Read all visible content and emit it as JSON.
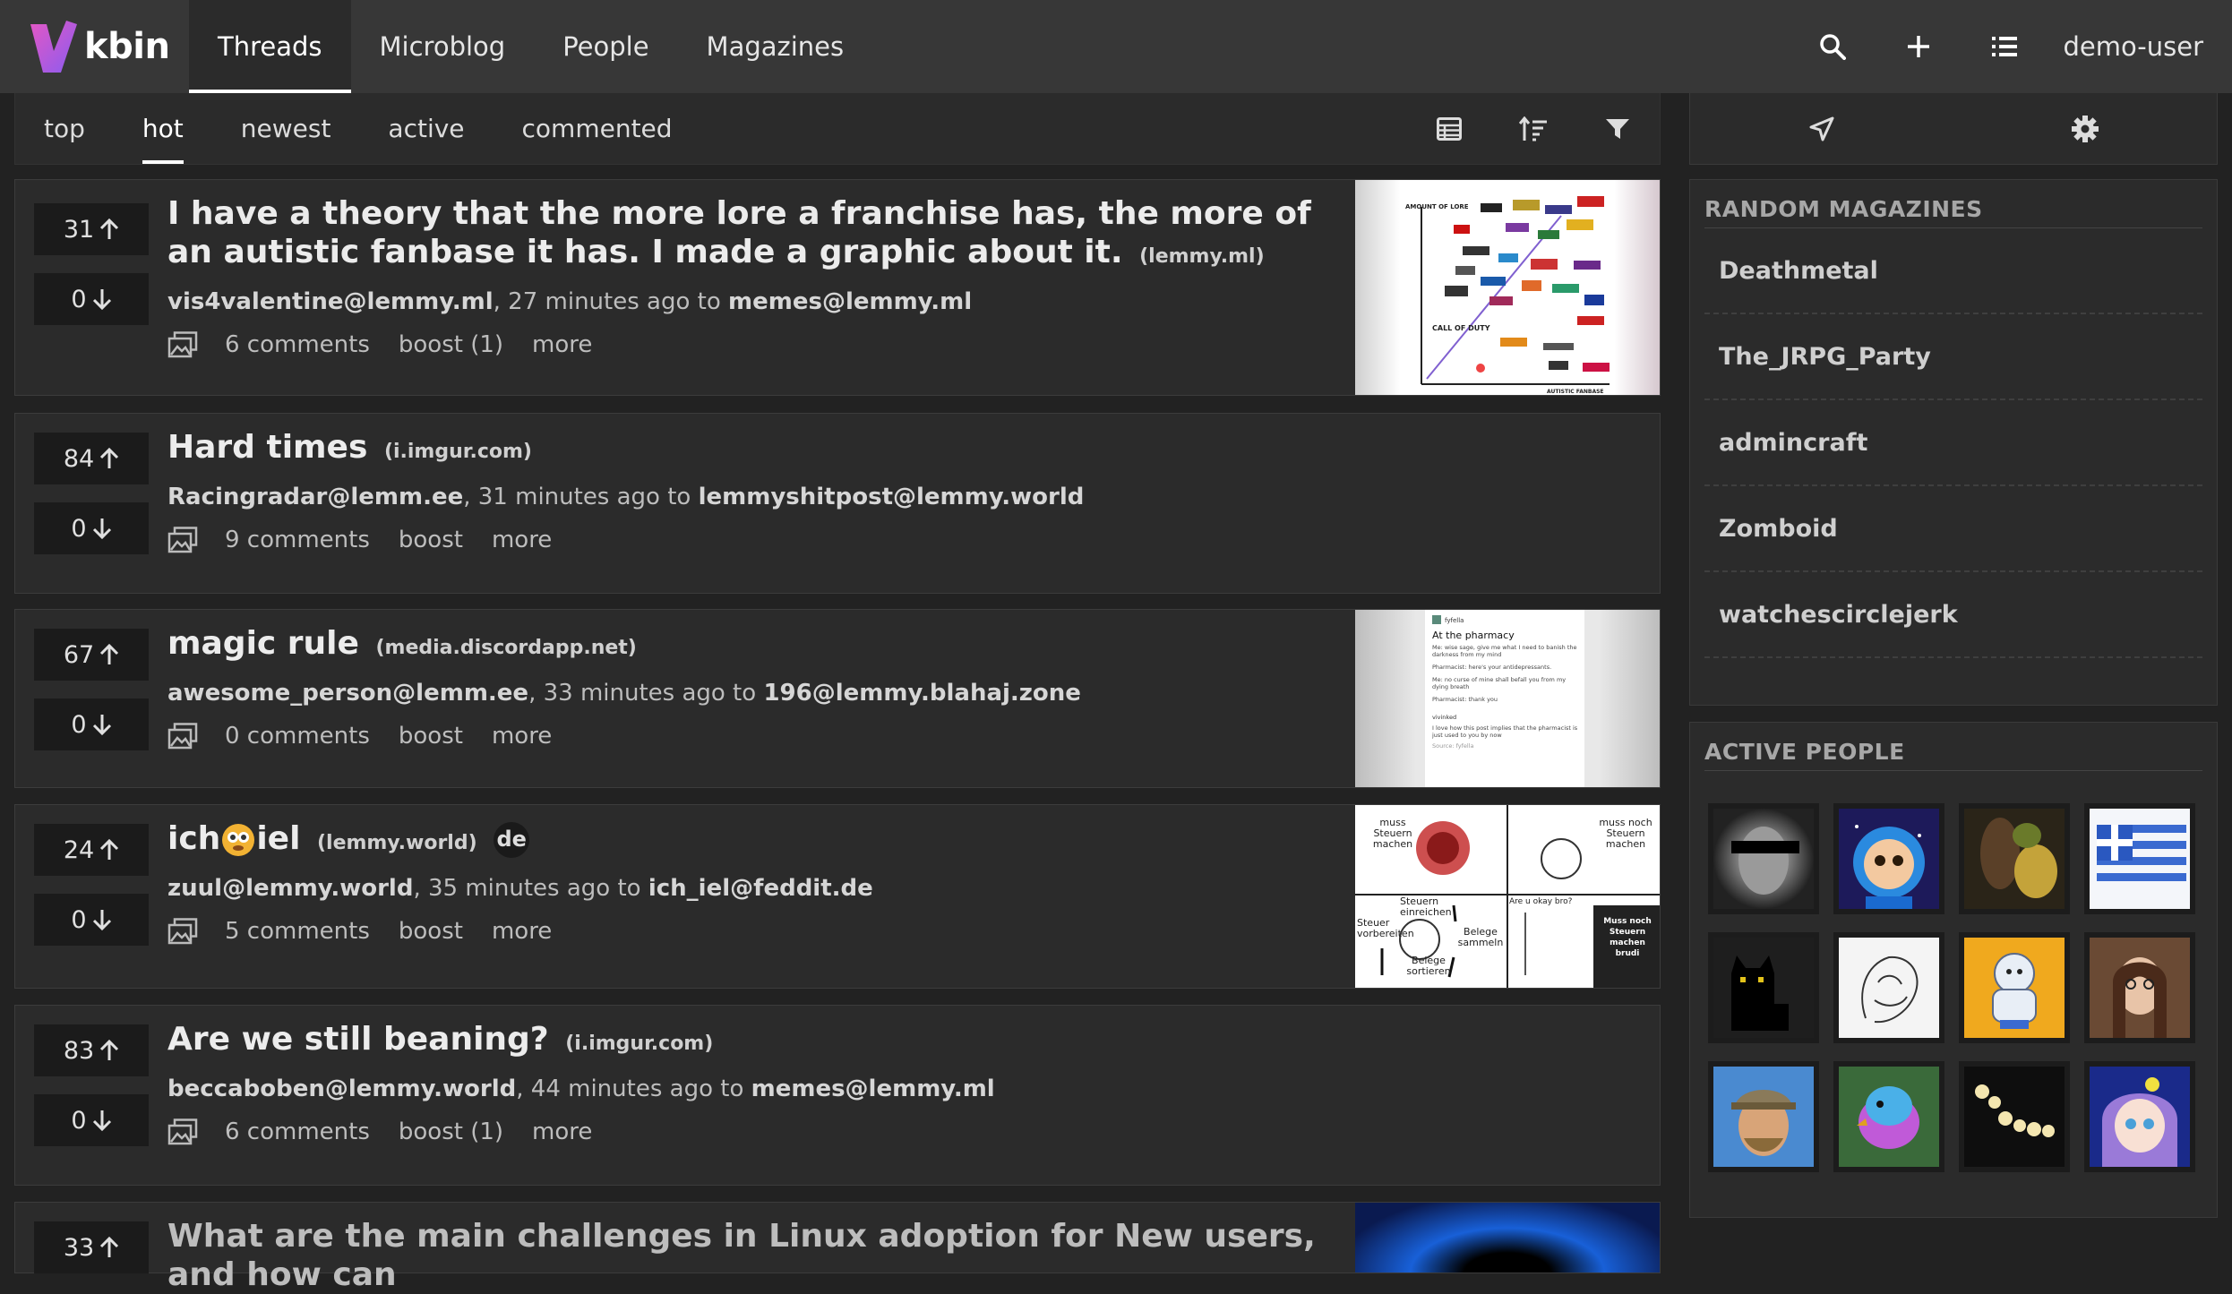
{
  "brand": {
    "name": "kbin"
  },
  "nav": {
    "tabs": [
      {
        "label": "Threads"
      },
      {
        "label": "Microblog"
      },
      {
        "label": "People"
      },
      {
        "label": "Magazines"
      }
    ],
    "active_tab": "Threads",
    "user": "demo-user",
    "icons": [
      "search-icon",
      "plus-icon",
      "list-icon"
    ]
  },
  "sort": {
    "tabs": [
      {
        "label": "top"
      },
      {
        "label": "hot"
      },
      {
        "label": "newest"
      },
      {
        "label": "active"
      },
      {
        "label": "commented"
      }
    ],
    "active": "hot",
    "icons": [
      "table-view-icon",
      "sort-options-icon",
      "filter-icon"
    ]
  },
  "entries": [
    {
      "up": "31",
      "down": "0",
      "title": "I have a theory that the more lore a franchise has, the more of an autistic fanbase it has. I made a graphic about it.",
      "domain": "(lemmy.ml)",
      "author": "vis4valentine@lemmy.ml",
      "time": ", 27 minutes ago to ",
      "magazine": "memes@lemmy.ml",
      "comments": "6 comments",
      "boost": "boost (1)",
      "more": "more",
      "thumb": {
        "ylabel": "AMOUNT OF LORE",
        "xlabel": "AUTISTIC FANBASE",
        "call": "CALL OF DUTY"
      }
    },
    {
      "up": "84",
      "down": "0",
      "title": "Hard times",
      "domain": "(i.imgur.com)",
      "author": "Racingradar@lemm.ee",
      "time": ", 31 minutes ago to ",
      "magazine": "lemmyshitpost@lemmy.world",
      "comments": "9 comments",
      "boost": "boost",
      "more": "more"
    },
    {
      "up": "67",
      "down": "0",
      "title": "magic rule",
      "domain": "(media.discordapp.net)",
      "author": "awesome_person@lemm.ee",
      "time": ", 33 minutes ago to ",
      "magazine": "196@lemmy.blahaj.zone",
      "comments": "0 comments",
      "boost": "boost",
      "more": "more",
      "thumb": {
        "user": "fyfella",
        "heading": "At the pharmacy",
        "line1": "Me: wise sage, give me what I need to banish the darkness from my mind",
        "line2": "Pharmacist: here's your antidepressants.",
        "line3": "Me: no curse of mine shall befall you from my dying breath",
        "line4": "Pharmacist: thank you",
        "user2": "vivinked",
        "line5": "I love how this post implies that the pharmacist is just used to you by now",
        "source": "Source: fyfella"
      }
    },
    {
      "up": "24",
      "down": "0",
      "title_pre": "ich",
      "title_post": "iel",
      "domain": "(lemmy.world)",
      "lang": "de",
      "author": "zuul@lemmy.world",
      "time": ", 35 minutes ago to ",
      "magazine": "ich_iel@feddit.de",
      "comments": "5 comments",
      "boost": "boost",
      "more": "more",
      "thumb": {
        "t1": "muss Steuern machen",
        "t2": "muss noch Steuern machen",
        "t3": "Steuern einreichen",
        "t4": "Steuer vorbereiten",
        "t5": "Belege sammeln",
        "t6": "Belege sortieren",
        "t7": "Are u okay bro?",
        "t8": "Muss noch Steuern machen brudi"
      }
    },
    {
      "up": "83",
      "down": "0",
      "title": "Are we still beaning?",
      "domain": "(i.imgur.com)",
      "author": "beccaboben@lemmy.world",
      "time": ", 44 minutes ago to ",
      "magazine": "memes@lemmy.ml",
      "comments": "6 comments",
      "boost": "boost (1)",
      "more": "more"
    },
    {
      "up": "33",
      "title": "What are the main challenges in Linux adoption for New users, and how can"
    }
  ],
  "sidebar": {
    "icons": [
      "send-icon",
      "settings-gear-icon"
    ],
    "random_magazines": {
      "heading": "RANDOM MAGAZINES",
      "items": [
        "Deathmetal",
        "The_JRPG_Party",
        "admincraft",
        "Zomboid",
        "watchescirclejerk"
      ]
    },
    "active_people": {
      "heading": "ACTIVE PEOPLE",
      "avatars": [
        "face-censored-avatar",
        "astronaut-cartoon-avatar",
        "jungle-avatar",
        "greek-flag-avatar",
        "black-cat-avatar",
        "sketch-drawing-avatar",
        "cartoon-gorilla-avatar",
        "woman-photo-avatar",
        "man-with-cap-avatar",
        "colorful-bird-avatar",
        "night-lights-avatar",
        "anime-girl-avatar"
      ]
    }
  }
}
